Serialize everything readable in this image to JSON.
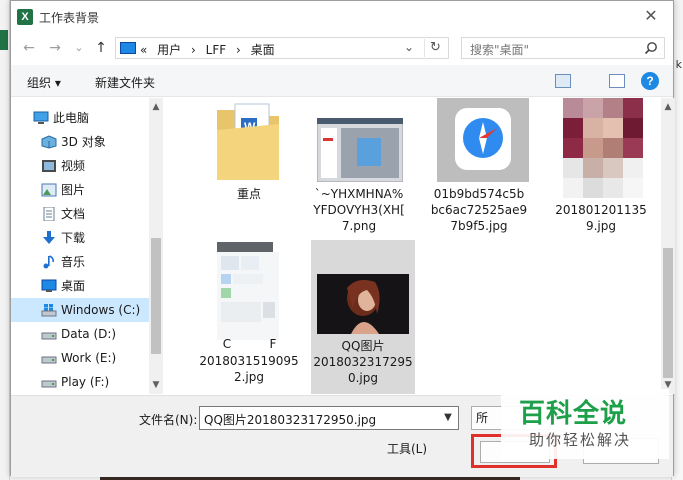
{
  "dialog": {
    "app_icon_letter": "X",
    "title": "工作表背景",
    "close_glyph": "✕"
  },
  "nav": {
    "back_glyph": "←",
    "forward_glyph": "→",
    "recent_glyph": "⌄",
    "up_glyph": "↑",
    "address_prefix": "«",
    "breadcrumbs": [
      "用户",
      "›",
      "LFF",
      "›",
      "桌面"
    ],
    "address_chevron": "⌄",
    "refresh_glyph": "↻",
    "search_placeholder": "搜索\"桌面\""
  },
  "toolbar": {
    "organize_label": "组织 ▾",
    "new_folder_label": "新建文件夹",
    "help_glyph": "?"
  },
  "sidebar": {
    "items": [
      {
        "label": "此电脑",
        "icon": "computer-icon"
      },
      {
        "label": "3D 对象",
        "icon": "cube-3d-icon"
      },
      {
        "label": "视频",
        "icon": "video-icon"
      },
      {
        "label": "图片",
        "icon": "pictures-icon"
      },
      {
        "label": "文档",
        "icon": "documents-icon"
      },
      {
        "label": "下载",
        "icon": "download-icon"
      },
      {
        "label": "音乐",
        "icon": "music-icon"
      },
      {
        "label": "桌面",
        "icon": "desktop-icon"
      },
      {
        "label": "Windows (C:)",
        "icon": "windows-drive-icon"
      },
      {
        "label": "Data (D:)",
        "icon": "drive-icon"
      },
      {
        "label": "Work (E:)",
        "icon": "drive-icon"
      },
      {
        "label": "Play (F:)",
        "icon": "drive-icon"
      }
    ],
    "selected_index": 8
  },
  "files": [
    {
      "name": "重点",
      "thumb": "folder-with-document-icon"
    },
    {
      "name": "`~YHXMHNA%YFDOVYH3(XH[7.png",
      "thumb": "screenshot-thumbnail"
    },
    {
      "name": "01b9bd574c5bbc6ac72525ae97b9f5.jpg",
      "thumb": "safari-compass-icon"
    },
    {
      "name": "20180120113559.jpg",
      "thumb": "blurred-photo-thumbnail"
    },
    {
      "name": "2018031519095 2.jpg",
      "thumb": "blurred-phone-screenshot"
    },
    {
      "name": "QQ图片20180323172950.jpg",
      "thumb": "portrait-photo-thumbnail"
    }
  ],
  "file_labels": {
    "f0": "重点",
    "f1": "`~YHXMHNA%\nYFDOVYH3(XH[\n7.png",
    "f2": "01b9bd574c5b\nbc6ac72525ae9\n7b9f5.jpg",
    "f3": "201801201135\n9.jpg",
    "f4_top": "C",
    "f4_mid": "F",
    "f4": "2018031519095\n2.jpg",
    "f5": "QQ图片\n2018032317295\n0.jpg"
  },
  "footer": {
    "filename_label": "文件名(N):",
    "filename_value": "QQ图片20180323172950.jpg",
    "filter_label": "所",
    "tools_label": "工具(L)"
  },
  "watermark": {
    "main": "百科全说",
    "sub": "助你轻松解决"
  },
  "background": {
    "right_glyph": "k"
  },
  "colors": {
    "selection": "#cce8ff",
    "accent": "#1e88e5",
    "excel_green": "#217346",
    "highlight_red": "#e0302b",
    "watermark_green": "#1ea04b"
  }
}
